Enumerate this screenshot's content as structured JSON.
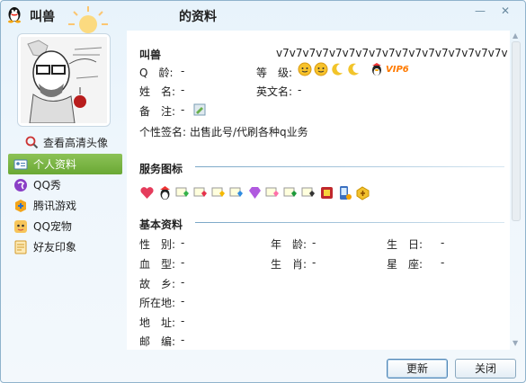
{
  "window": {
    "name": "叫兽",
    "title_suffix": "的资料",
    "minimize": "—",
    "close": "✕"
  },
  "left": {
    "hd_link": "查看高清头像",
    "nav": [
      {
        "label": "个人资料",
        "active": true
      },
      {
        "label": "QQ秀",
        "active": false
      },
      {
        "label": "腾讯游戏",
        "active": false
      },
      {
        "label": "QQ宠物",
        "active": false
      },
      {
        "label": "好友印象",
        "active": false
      }
    ]
  },
  "profile": {
    "nickname": "叫兽",
    "qq_label": "Q　龄:",
    "qq_value": "-",
    "level_label": "等　级:",
    "level_badge": "VIP6",
    "long_text": "v7v7v7v7v7v7v7v7v7v7v7v7v7v7v7v7v7v",
    "name_label": "姓　名:",
    "name_value": "-",
    "en_label": "英文名:",
    "en_value": "-",
    "note_label": "备　注:",
    "note_value": "-",
    "sign_label": "个性签名:",
    "sign_value": "出售此号/代刷各种q业务"
  },
  "services": {
    "title": "服务图标"
  },
  "basic": {
    "title": "基本资料",
    "rows": [
      [
        {
          "k": "性　别:",
          "v": "-"
        },
        {
          "k": "年　龄:",
          "v": "-"
        },
        {
          "k": "生　日:",
          "v": "-"
        }
      ],
      [
        {
          "k": "血　型:",
          "v": "-"
        },
        {
          "k": "生　肖:",
          "v": "-"
        },
        {
          "k": "星　座:",
          "v": "-"
        }
      ],
      [
        {
          "k": "故　乡:",
          "v": "-"
        }
      ],
      [
        {
          "k": "所在地:",
          "v": "-"
        }
      ],
      [
        {
          "k": "地　址:",
          "v": "-"
        }
      ],
      [
        {
          "k": "邮　编:",
          "v": "-"
        }
      ]
    ]
  },
  "buttons": {
    "update": "更新",
    "close": "关闭"
  },
  "colors": {
    "accent_green": "#6aa834",
    "vip_orange": "#ff7a00",
    "section_line": "#7aa7c7"
  }
}
